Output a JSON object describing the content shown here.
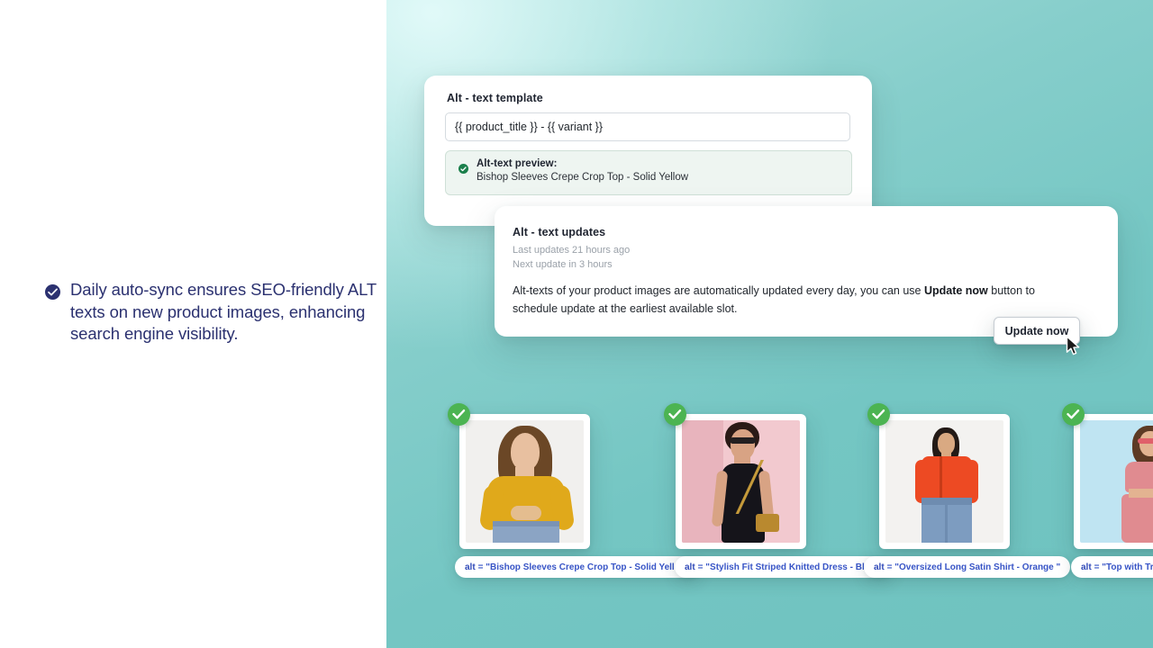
{
  "left": {
    "bullet_icon": "check-circle-icon",
    "bullet_text": "Daily auto-sync ensures SEO-friendly ALT texts on new product images, enhancing search engine visibility.",
    "accent_color": "#2b3170"
  },
  "template_card": {
    "title": "Alt - text template",
    "input_value": "{{ product_title }} - {{ variant }}",
    "input_placeholder": "{{ product_title }} - {{ variant }}",
    "preview_icon": "check-circle-icon",
    "preview_label": "Alt-text preview:",
    "preview_value": "Bishop Sleeves Crepe Crop Top - Solid Yellow",
    "preview_accent": "#1a7f4b"
  },
  "updates_card": {
    "title": "Alt - text updates",
    "last_update": "Last updates 21 hours ago",
    "next_update": "Next update in 3 hours",
    "body_part1": "Alt-texts of your product images are automatically updated every day, you can use ",
    "body_strong": "Update now",
    "body_part2": " button to schedule update at the earliest available slot."
  },
  "update_button": {
    "label": "Update now",
    "cursor_icon": "mouse-pointer-icon"
  },
  "products": [
    {
      "badge_icon": "check-circle-icon",
      "alt_key": "alt",
      "alt_value": "= \"Bishop Sleeves Crepe Crop Top - Solid Yellow\"",
      "photo_name": "woman-yellow-crop-top",
      "bg_color": "#f1f0ee",
      "garment_color": "#e0a91b"
    },
    {
      "badge_icon": "check-circle-icon",
      "alt_key": "alt",
      "alt_value": "= \"Stylish Fit Striped Knitted Dress - Black\"",
      "photo_name": "woman-black-knitted-dress",
      "bg_color": "#f2c9cf",
      "garment_color": "#15141a"
    },
    {
      "badge_icon": "check-circle-icon",
      "alt_key": "alt",
      "alt_value": "= \"Oversized Long Satin Shirt - Orange \"",
      "photo_name": "woman-orange-satin-shirt",
      "bg_color": "#f3f2f0",
      "garment_color": "#ed4a23"
    },
    {
      "badge_icon": "check-circle-icon",
      "alt_key": "alt",
      "alt_value": "= \"Top with Trousers",
      "photo_name": "woman-pink-top-trousers",
      "bg_color": "#bfe4f2",
      "garment_color": "#e08b90"
    }
  ],
  "background": {
    "gradient_from": "#c8eeee",
    "gradient_to": "#6ec2bf",
    "left_panel_color": "#ffffff"
  }
}
